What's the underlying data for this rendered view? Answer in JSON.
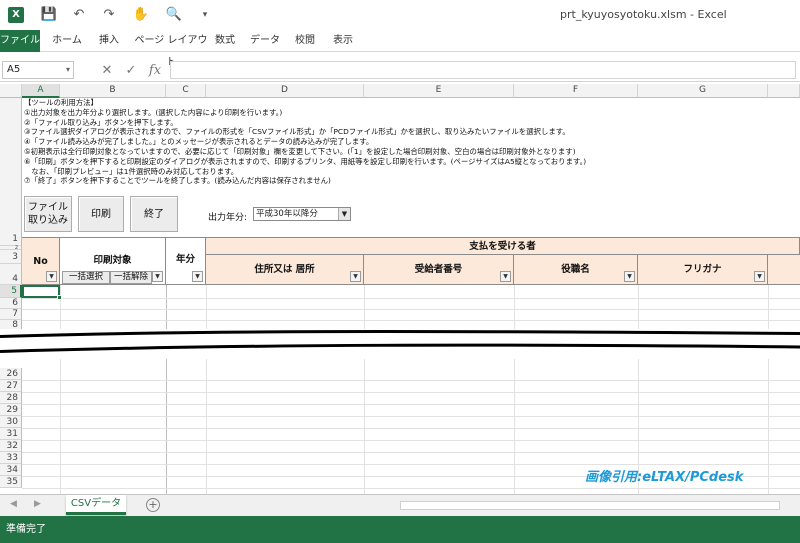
{
  "titlebar": {
    "app_icon": "excel-icon",
    "document_title": "prt_kyuyosyotoku.xlsm - Excel",
    "quick_access": [
      "save-icon",
      "undo-icon",
      "redo-icon",
      "touch-mode-icon",
      "print-preview-icon",
      "customize-icon"
    ]
  },
  "ribbon": {
    "tabs": [
      "ファイル",
      "ホーム",
      "挿入",
      "ページ レイアウト",
      "数式",
      "データ",
      "校閲",
      "表示"
    ]
  },
  "formula_bar": {
    "name_box": "A5",
    "cancel_icon": "close-icon",
    "enter_icon": "check-icon",
    "fx_label": "fx",
    "content": ""
  },
  "columns": [
    "A",
    "B",
    "C",
    "D",
    "E",
    "F",
    "G"
  ],
  "rows_top": [
    "1",
    "2",
    "3",
    "4",
    "5",
    "6",
    "7",
    "8"
  ],
  "rows_bottom": [
    "26",
    "27",
    "28",
    "29",
    "30",
    "31",
    "32",
    "33",
    "34",
    "35"
  ],
  "instructions": [
    "【ツールの利用方法】",
    "①出力対象を出力年分より選択します。(選択した内容により印刷を行います。)",
    "②「ファイル取り込み」ボタンを押下します。",
    "③ファイル選択ダイアログが表示されますので、ファイルの形式を「CSVファイル形式」か「PCDファイル形式」かを選択し、取り込みたいファイルを選択します。",
    "④「ファイル読み込みが完了しました。」とのメッセージが表示されるとデータの読み込みが完了します。",
    "⑤初期表示は全行印刷対象となっていますので、必要に応じて「印刷対象」欄を変更して下さい。(「1」を設定した場合印刷対象、空白の場合は印刷対象外となります)",
    "⑥「印刷」ボタンを押下すると印刷設定のダイアログが表示されますので、印刷するプリンタ、用紙等を設定し印刷を行います。(ページサイズはA5縦となっております。)",
    "　なお、「印刷プレビュー」は1件選択時のみ対応しております。",
    "⑦「終了」ボタンを押下することでツールを終了します。(読み込んだ内容は保存されません)"
  ],
  "buttons": {
    "import": [
      "ファイル",
      "取り込み"
    ],
    "print": "印刷",
    "exit": "終了"
  },
  "year_selector": {
    "label": "出力年分:",
    "value": "平成30年以降分"
  },
  "table_header": {
    "group": "支払を受ける者",
    "no": "No",
    "print_target": "印刷対象",
    "select_all": "一括選択",
    "deselect_all": "一括解除",
    "year": "年分",
    "address": "住所又は 居所",
    "recipient_number": "受給者番号",
    "position": "役職名",
    "furigana": "フリガナ"
  },
  "watermark": "画像引用:eLTAX/PCdesk",
  "sheet_tabs": [
    "CSVデータ"
  ],
  "status": "準備完了"
}
